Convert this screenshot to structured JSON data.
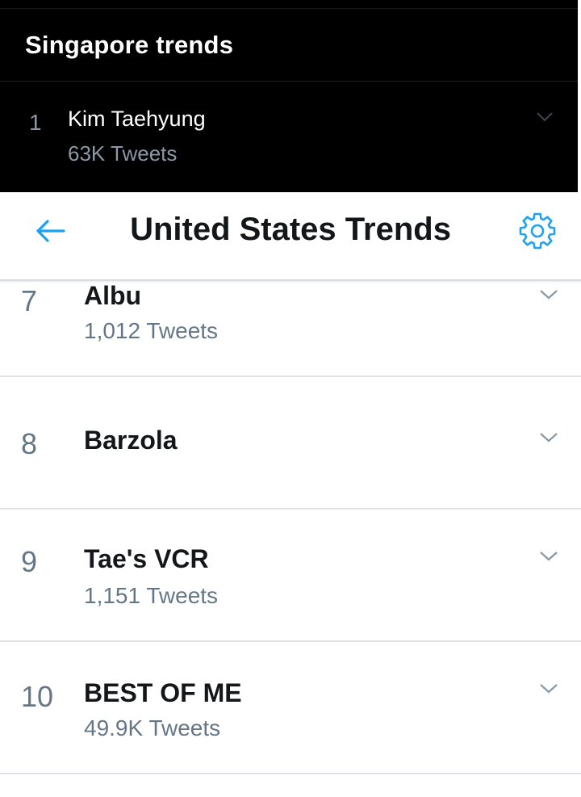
{
  "singapore": {
    "title": "Singapore trends",
    "trend": {
      "rank": "1",
      "name": "Kim Taehyung",
      "tweets": "63K Tweets"
    }
  },
  "us": {
    "title": "United States Trends",
    "trends": [
      {
        "rank": "7",
        "name": "Albu",
        "tweets": "1,012 Tweets"
      },
      {
        "rank": "8",
        "name": "Barzola",
        "tweets": ""
      },
      {
        "rank": "9",
        "name": "Tae's VCR",
        "tweets": "1,151 Tweets"
      },
      {
        "rank": "10",
        "name": "BEST OF ME",
        "tweets": "49.9K Tweets"
      }
    ]
  },
  "icons": {
    "back": "arrow-left-icon",
    "settings": "gear-icon",
    "more": "chevron-down-icon"
  },
  "colors": {
    "accent": "#1da1f2",
    "dark_bg": "#000000",
    "muted_text": "#657786"
  }
}
